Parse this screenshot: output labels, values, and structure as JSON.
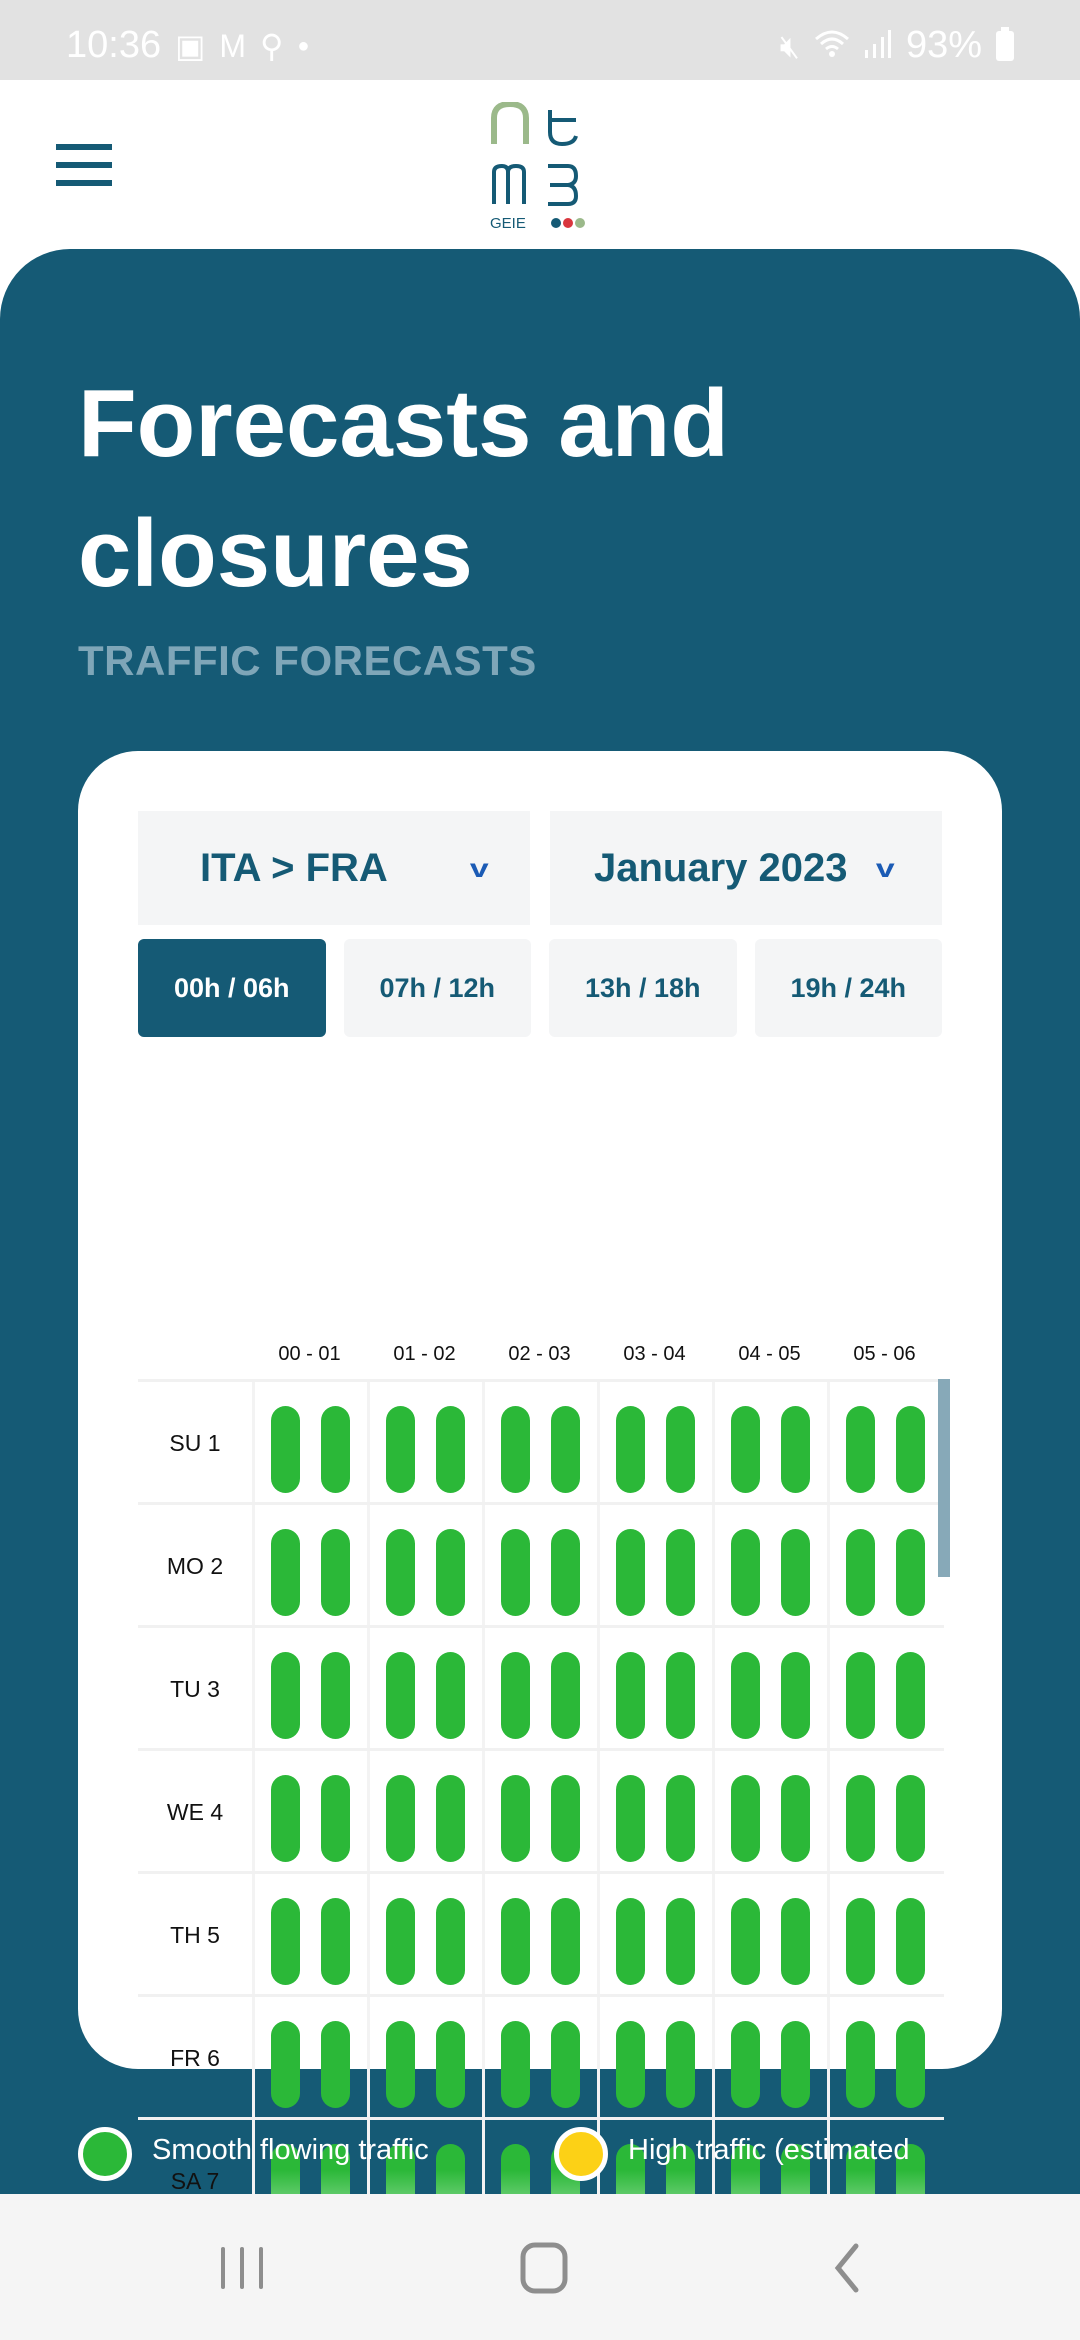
{
  "status_bar": {
    "time": "10:36",
    "battery": "93%",
    "left_icons": [
      "gallery-icon",
      "gmail-icon",
      "keyhole-icon",
      "dot-icon"
    ],
    "right_icons": [
      "mute-icon",
      "wifi-icon",
      "signal-icon",
      "battery-icon"
    ]
  },
  "header": {
    "menu_icon": "hamburger-menu-icon",
    "logo_text": "GEIE",
    "logo_alt": "ntm3 GEIE"
  },
  "hero": {
    "title": "Forecasts and closures",
    "subtitle": "TRAFFIC FORECASTS"
  },
  "filters": {
    "route": {
      "value": "ITA > FRA",
      "icon": "chevron-down-icon"
    },
    "month": {
      "value": "January 2023",
      "icon": "chevron-down-icon"
    }
  },
  "time_tabs": [
    {
      "label": "00h / 06h",
      "active": true
    },
    {
      "label": "07h / 12h",
      "active": false
    },
    {
      "label": "13h / 18h",
      "active": false
    },
    {
      "label": "19h / 24h",
      "active": false
    }
  ],
  "grid": {
    "columns": [
      "00 - 01",
      "01 - 02",
      "02 - 03",
      "03 - 04",
      "04 - 05",
      "05 - 06"
    ],
    "rows": [
      {
        "label": "SU 1",
        "status": [
          "smooth",
          "smooth",
          "smooth",
          "smooth",
          "smooth",
          "smooth",
          "smooth",
          "smooth",
          "smooth",
          "smooth",
          "smooth",
          "smooth"
        ]
      },
      {
        "label": "MO 2",
        "status": [
          "smooth",
          "smooth",
          "smooth",
          "smooth",
          "smooth",
          "smooth",
          "smooth",
          "smooth",
          "smooth",
          "smooth",
          "smooth",
          "smooth"
        ]
      },
      {
        "label": "TU 3",
        "status": [
          "smooth",
          "smooth",
          "smooth",
          "smooth",
          "smooth",
          "smooth",
          "smooth",
          "smooth",
          "smooth",
          "smooth",
          "smooth",
          "smooth"
        ]
      },
      {
        "label": "WE 4",
        "status": [
          "smooth",
          "smooth",
          "smooth",
          "smooth",
          "smooth",
          "smooth",
          "smooth",
          "smooth",
          "smooth",
          "smooth",
          "smooth",
          "smooth"
        ]
      },
      {
        "label": "TH 5",
        "status": [
          "smooth",
          "smooth",
          "smooth",
          "smooth",
          "smooth",
          "smooth",
          "smooth",
          "smooth",
          "smooth",
          "smooth",
          "smooth",
          "smooth"
        ]
      },
      {
        "label": "FR 6",
        "status": [
          "smooth",
          "smooth",
          "smooth",
          "smooth",
          "smooth",
          "smooth",
          "smooth",
          "smooth",
          "smooth",
          "smooth",
          "smooth",
          "smooth"
        ]
      },
      {
        "label": "SA 7",
        "status": [
          "smooth",
          "smooth",
          "smooth",
          "smooth",
          "smooth",
          "smooth",
          "smooth",
          "smooth",
          "smooth",
          "smooth",
          "smooth",
          "smooth"
        ]
      }
    ]
  },
  "legend": [
    {
      "label": "Smooth flowing traffic",
      "color": "#2bb838"
    },
    {
      "label": "High traffic (estimated",
      "color": "#fcd116"
    }
  ],
  "colors": {
    "brand": "#155a75",
    "smooth": "#2bb838",
    "high": "#fcd116",
    "subtitle": "#7fa6b8"
  },
  "nav": {
    "recent_icon": "recent-apps-icon",
    "home_icon": "home-icon",
    "back_icon": "back-icon"
  }
}
